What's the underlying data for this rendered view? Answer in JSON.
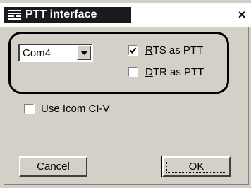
{
  "window": {
    "title": "PTT interface",
    "icon": "ptt-app-icon",
    "close_glyph": "×"
  },
  "port": {
    "selected": "Com4",
    "arrow_icon": "chevron-down-icon"
  },
  "options": {
    "rts": {
      "mnemonic": "R",
      "rest": "TS as PTT",
      "checked": true
    },
    "dtr": {
      "mnemonic": "D",
      "rest": "TR as PTT",
      "checked": false
    },
    "icom": {
      "label": "Use Icom CI-V",
      "checked": false
    }
  },
  "buttons": {
    "cancel": "Cancel",
    "ok": "OK"
  },
  "colors": {
    "face": "#d4d0c8",
    "title_bg": "#1a1a1a"
  }
}
